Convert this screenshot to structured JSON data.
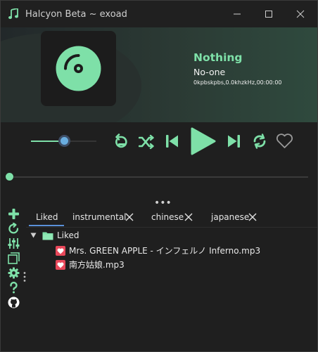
{
  "window": {
    "title": "Halcyon Beta ~ exoad",
    "accent": "#7ee0a8"
  },
  "now_playing": {
    "title": "Nothing",
    "artist": "No-one",
    "info": "0kpbskpbs,0.0khzkHz,00:00:00"
  },
  "volume_level": 0.5,
  "seek_progress": 0.0,
  "tabs": [
    {
      "label": "Liked",
      "active": true,
      "closable": false
    },
    {
      "label": "instrumental",
      "active": false,
      "closable": true
    },
    {
      "label": "chinese",
      "active": false,
      "closable": true
    },
    {
      "label": "japanese",
      "active": false,
      "closable": true
    }
  ],
  "tree": {
    "folder_label": "Liked",
    "tracks": [
      {
        "label": "Mrs. GREEN APPLE - インフェルノ Inferno.mp3"
      },
      {
        "label": "南方姑娘.mp3"
      }
    ]
  },
  "icons": {
    "app": "music-note-icon",
    "toolbar": [
      "add-icon",
      "refresh-icon",
      "equalizer-icon",
      "playlist-icon",
      "settings-icon",
      "help-icon",
      "github-icon"
    ]
  }
}
